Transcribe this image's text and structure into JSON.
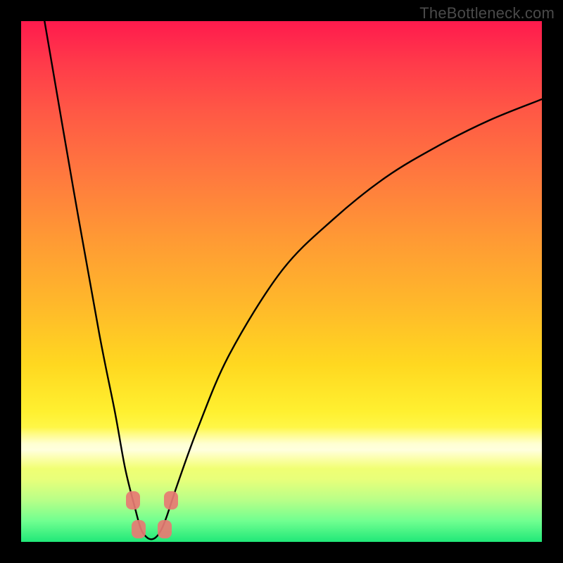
{
  "watermark": {
    "text": "TheBottleneck.com"
  },
  "colors": {
    "frame_bg": "#000000",
    "curve_stroke": "#000000",
    "marker_fill": "#e77a73",
    "gradient_stops": [
      "#ff1a4d",
      "#ff3a4a",
      "#ff5a45",
      "#ff7a3e",
      "#ff9a34",
      "#ffba2a",
      "#ffd820",
      "#fff030",
      "#ffff66",
      "#e8ff7a",
      "#b8ff88",
      "#70ff90",
      "#20e878"
    ]
  },
  "chart_data": {
    "type": "line",
    "title": "",
    "xlabel": "",
    "ylabel": "",
    "xlim": [
      0,
      100
    ],
    "ylim": [
      0,
      100
    ],
    "grid": false,
    "legend": false,
    "curve_description": "V-shaped bottleneck curve: steep descent on left, flat near x≈23–27, asymptotic rise on right",
    "x": [
      4.5,
      10,
      15,
      18,
      20,
      22,
      23,
      24,
      25,
      26,
      27,
      28,
      30,
      34,
      40,
      50,
      60,
      70,
      80,
      90,
      100
    ],
    "y": [
      100,
      68,
      40,
      25,
      14,
      6,
      2.5,
      1,
      0.5,
      1,
      2.5,
      5,
      11,
      22,
      36,
      52,
      62,
      70,
      76,
      81,
      85
    ],
    "markers": [
      {
        "x": 21.5,
        "y": 8
      },
      {
        "x": 28.8,
        "y": 8
      },
      {
        "x": 22.5,
        "y": 2.5
      },
      {
        "x": 27.5,
        "y": 2.5
      }
    ]
  }
}
